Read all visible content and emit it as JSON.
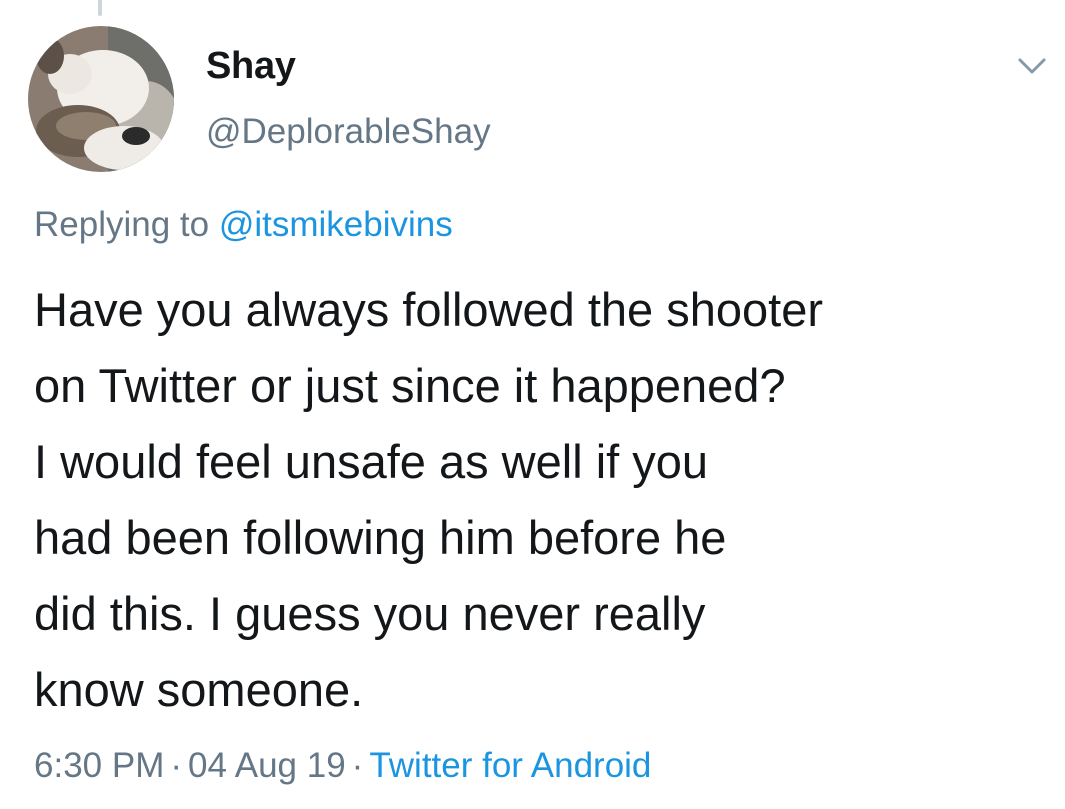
{
  "author": {
    "display_name": "Shay",
    "handle": "@DeplorableShay"
  },
  "reply": {
    "prefix": "Replying to",
    "mention": "@itsmikebivins"
  },
  "tweet": {
    "lines": [
      "Have you always followed the shooter",
      "on Twitter or just since it happened?",
      "I would feel unsafe as well if you",
      "had been following him before he",
      "did this. I guess you never really",
      "know someone."
    ]
  },
  "meta": {
    "time": "6:30 PM",
    "separator": "·",
    "date": "04 Aug 19",
    "source": "Twitter for Android"
  },
  "icons": {
    "menu": "chevron-down-icon",
    "avatar": "cats-photo"
  },
  "colors": {
    "text": "#14171a",
    "secondary": "#657786",
    "link": "#1b95e0",
    "thread_line": "#ccd6dd"
  }
}
